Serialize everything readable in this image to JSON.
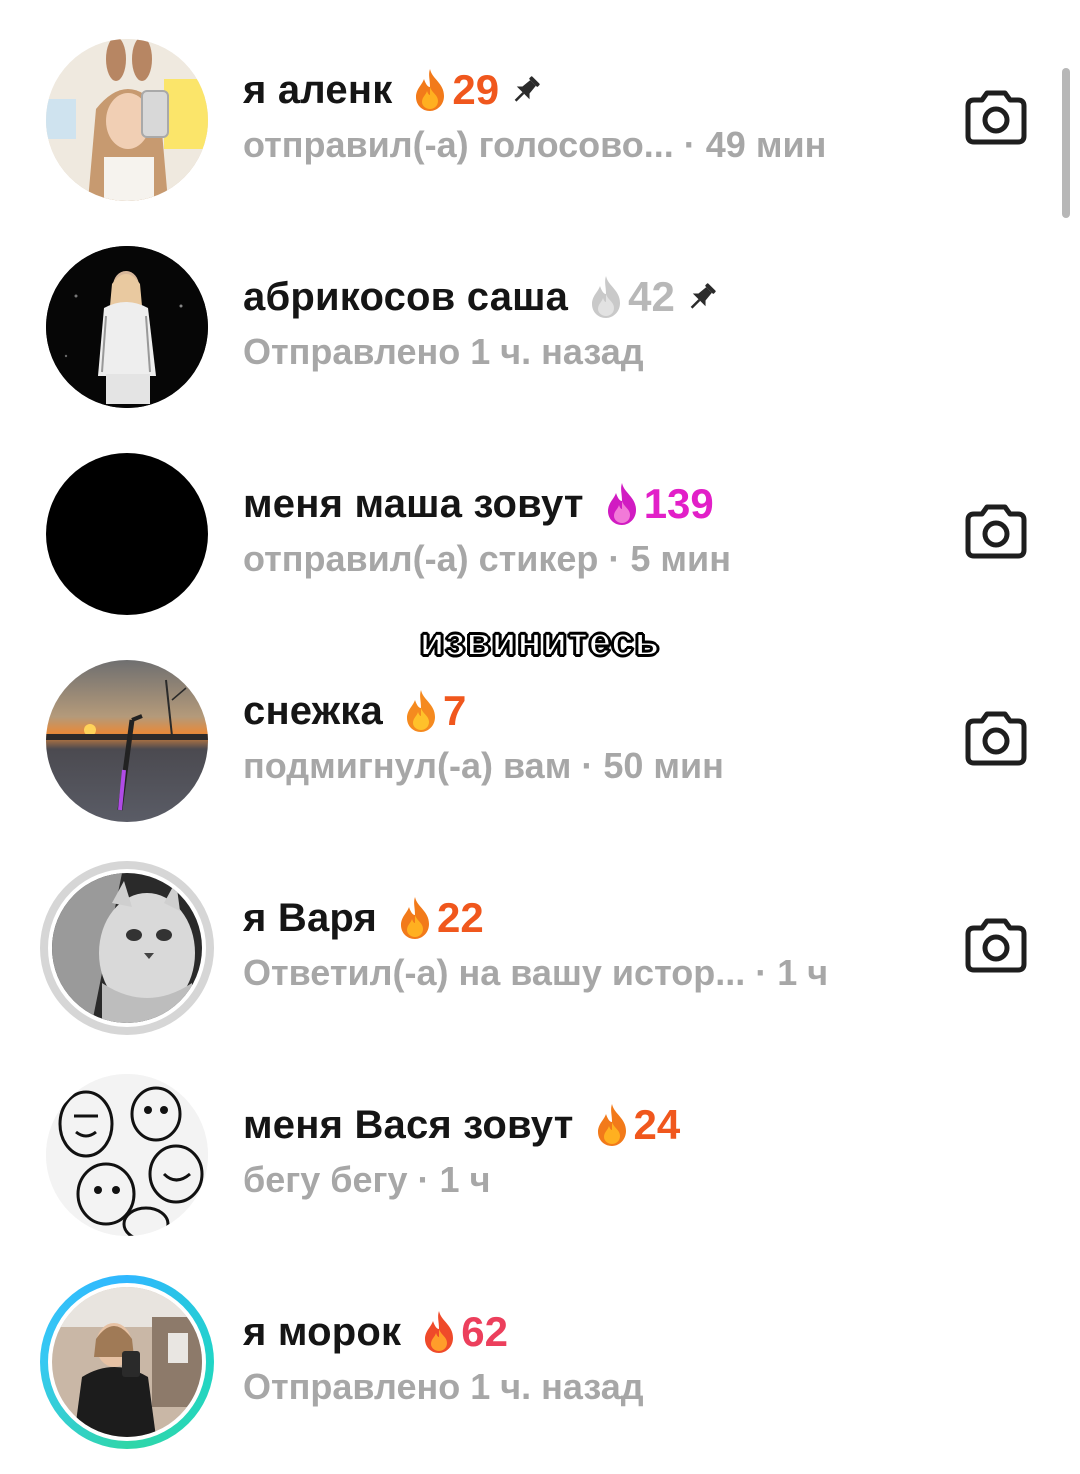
{
  "overlay_caption": "извинитесь",
  "colors": {
    "streak_orange": "#f0571d",
    "streak_pink": "#e21fc8",
    "streak_grey": "#b8b8b8",
    "subtitle_grey": "#a7a7a7",
    "name_black": "#151515"
  },
  "chats": [
    {
      "name": "я аленк",
      "streak": "29",
      "streak_style": "orange",
      "pinned": true,
      "subtitle": "отправил(-а) голосово... · 49 мин",
      "camera_icon": true,
      "avatar_ring": "none"
    },
    {
      "name": "абрикосов саша",
      "streak": "42",
      "streak_style": "grey",
      "pinned": true,
      "subtitle": "Отправлено 1 ч. назад",
      "camera_icon": false,
      "avatar_ring": "none"
    },
    {
      "name": "меня маша зовут",
      "streak": "139",
      "streak_style": "pink",
      "pinned": false,
      "subtitle": "отправил(-а) стикер · 5 мин",
      "camera_icon": true,
      "avatar_ring": "none"
    },
    {
      "name": "снежка",
      "streak": "7",
      "streak_style": "orange",
      "pinned": false,
      "subtitle": "подмигнул(-а) вам · 50 мин",
      "camera_icon": true,
      "avatar_ring": "none"
    },
    {
      "name": "я Варя",
      "streak": "22",
      "streak_style": "orange",
      "pinned": false,
      "subtitle": "Ответил(-а) на вашу истор...  · 1 ч",
      "camera_icon": true,
      "avatar_ring": "grey"
    },
    {
      "name": "меня Вася зовут",
      "streak": "24",
      "streak_style": "orange",
      "pinned": false,
      "subtitle": "бегу бегу · 1 ч",
      "camera_icon": false,
      "avatar_ring": "none"
    },
    {
      "name": "я морок",
      "streak": "62",
      "streak_style": "orange",
      "pinned": false,
      "subtitle": "Отправлено 1 ч. назад",
      "camera_icon": false,
      "avatar_ring": "teal"
    }
  ]
}
